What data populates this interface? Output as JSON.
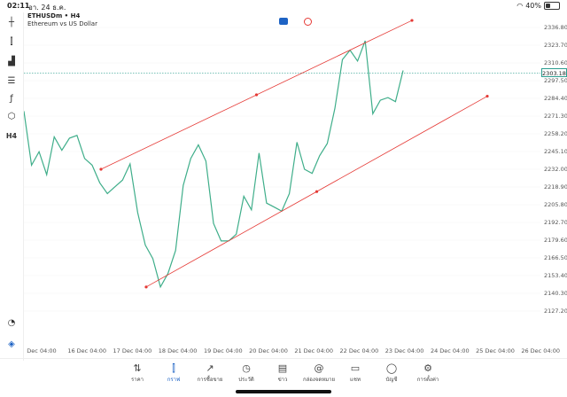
{
  "status": {
    "time": "02:11",
    "date": "อา. 24 ธ.ค.",
    "battery": "40%",
    "battery_level": 0.4
  },
  "header": {
    "symbol_line": "ETHUSDm • H4",
    "description": "Ethereum vs US Dollar"
  },
  "toolbar": {
    "icons": [
      "crosshair-icon",
      "candles-icon",
      "bars-icon",
      "indicators-icon",
      "function-icon",
      "objects-icon",
      "timeframe-icon"
    ],
    "timeframe": "H4",
    "bottom_icons": [
      "gauge-icon",
      "logo-icon"
    ]
  },
  "yaxis": {
    "labels": [
      "2336.80",
      "2323.70",
      "2310.60",
      "2297.50",
      "2284.40",
      "2271.30",
      "2258.20",
      "2245.10",
      "2232.00",
      "2218.90",
      "2205.80",
      "2192.70",
      "2179.60",
      "2166.50",
      "2153.40",
      "2140.30",
      "2127.20"
    ],
    "current_price": "2303.18"
  },
  "xaxis": {
    "labels": [
      "Dec 04:00",
      "16 Dec 04:00",
      "17 Dec 04:00",
      "18 Dec 04:00",
      "19 Dec 04:00",
      "20 Dec 04:00",
      "21 Dec 04:00",
      "22 Dec 04:00",
      "23 Dec 04:00",
      "24 Dec 04:00",
      "25 Dec 04:00",
      "26 Dec 04:00"
    ]
  },
  "chart_data": {
    "type": "line",
    "series": [
      {
        "values": [
          2275,
          2235,
          2245,
          2228,
          2256,
          2246,
          2255,
          2257,
          2240,
          2235,
          2222,
          2214,
          2219,
          2224,
          2236,
          2200,
          2176,
          2166,
          2145,
          2155,
          2172,
          2220,
          2240,
          2250,
          2238,
          2192,
          2179,
          2179,
          2184,
          2212,
          2202,
          2244,
          2207,
          2204,
          2201,
          2214,
          2252,
          2232,
          2229,
          2242,
          2251,
          2277,
          2313,
          2320,
          2312,
          2327,
          2273,
          2283,
          2285,
          2282,
          2305
        ]
      }
    ],
    "channel": {
      "upper": [
        2232,
        2342
      ],
      "lower": [
        2145,
        2286
      ]
    },
    "current_price": 2303.18,
    "line_color": "#3fae8a",
    "channel_color": "#e53935",
    "price_line_color": "#2a9d8f"
  },
  "nav": [
    {
      "label": "ราคา",
      "icon": "quotes-icon",
      "active": false
    },
    {
      "label": "กราฟ",
      "icon": "chart-icon",
      "active": true
    },
    {
      "label": "การซื้อขาย",
      "icon": "trade-icon",
      "active": false
    },
    {
      "label": "ประวัติ",
      "icon": "history-icon",
      "active": false
    },
    {
      "label": "ข่าว",
      "icon": "news-icon",
      "active": false
    },
    {
      "label": "กล่องจดหมาย",
      "icon": "mailbox-icon",
      "active": false
    },
    {
      "label": "แชท",
      "icon": "chat-icon",
      "active": false
    },
    {
      "label": "บัญชี",
      "icon": "account-icon",
      "active": false
    },
    {
      "label": "การตั้งค่า",
      "icon": "settings-icon",
      "active": false
    }
  ]
}
